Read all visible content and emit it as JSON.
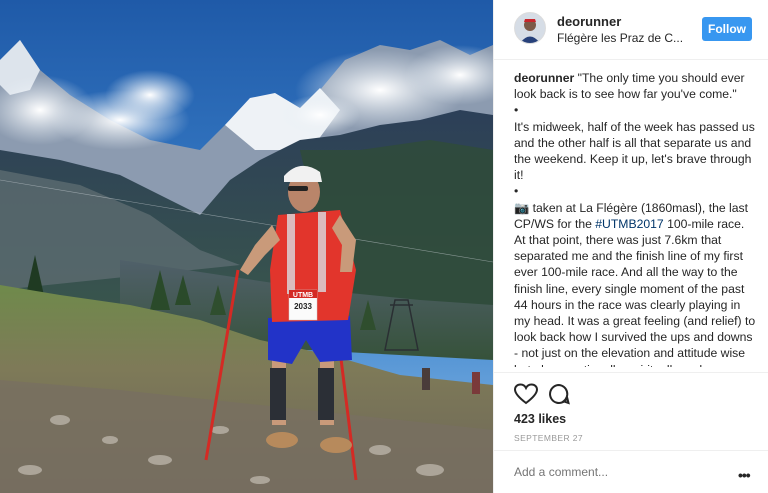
{
  "post": {
    "username": "deorunner",
    "location": "Flégère les Praz de C...",
    "follow_label": "Follow",
    "caption": {
      "author": "deorunner",
      "quote": "\"The only time you should ever look back is to see how far you've come.\"",
      "bullet1": "•",
      "para1": "It's midweek, half of the week has passed us and the other half is all that separate us and the weekend. Keep it up, let's brave through it!",
      "bullet2": "•",
      "camera_emoji": "📷",
      "para2_start": " taken at La Flégère (1860masl), the last CP/WS for the ",
      "hashtag": "#UTMB2017",
      "para2_end": " 100-mile race. At that point, there was just 7.6km that separated me and the finish line of my first ever 100-mile race. And all the way to the finish line, every single moment of the past 44 hours in the race was clearly playing in my head. It was a great feeling (and relief) to look back how I survived the ups and downs - not just on the elevation and attitude wise but also emotionally, spiritually and physically; that had brought me to the finish line."
    },
    "likes": "423 likes",
    "date": "SEPTEMBER 27",
    "comment_placeholder": "Add a comment...",
    "more_label": "•••",
    "bib": {
      "brand": "UTMB",
      "number": "2033"
    }
  },
  "colors": {
    "accent": "#3897f0",
    "hashtag": "#003569",
    "muted": "#999999"
  },
  "icons": [
    "heart-icon",
    "comment-icon",
    "more-options-icon",
    "camera-emoji"
  ]
}
